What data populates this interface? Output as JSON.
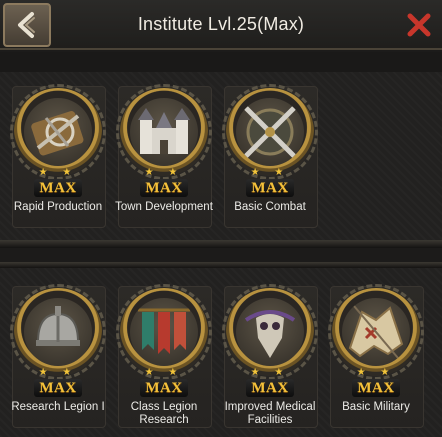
{
  "header": {
    "title": "Institute Lvl.25(Max)",
    "back_icon": "back-arrow-icon",
    "close_icon": "close-x-icon"
  },
  "colors": {
    "accent_gold": "#f2c43a",
    "close_red": "#c8362b"
  },
  "sections": [
    {
      "cards": [
        {
          "label": "Rapid Production",
          "badge": "MAX",
          "stars": "★ ★",
          "icon": "scroll-compass-icon"
        },
        {
          "label": "Town Development",
          "badge": "MAX",
          "stars": "★ ★",
          "icon": "castle-icon"
        },
        {
          "label": "Basic Combat",
          "badge": "MAX",
          "stars": "★ ★",
          "icon": "crossed-swords-shield-icon"
        }
      ]
    },
    {
      "cards": [
        {
          "label": "Research Legion I",
          "badge": "MAX",
          "stars": "★ ★",
          "icon": "helmet-icon"
        },
        {
          "label": "Class Legion Research",
          "badge": "MAX",
          "stars": "★ ★",
          "icon": "banners-icon"
        },
        {
          "label": "Improved Medical Facilities",
          "badge": "MAX",
          "stars": "★ ★",
          "icon": "plague-mask-icon"
        },
        {
          "label": "Basic Military",
          "badge": "MAX",
          "stars": "★ ★",
          "icon": "war-map-icon"
        }
      ]
    }
  ]
}
